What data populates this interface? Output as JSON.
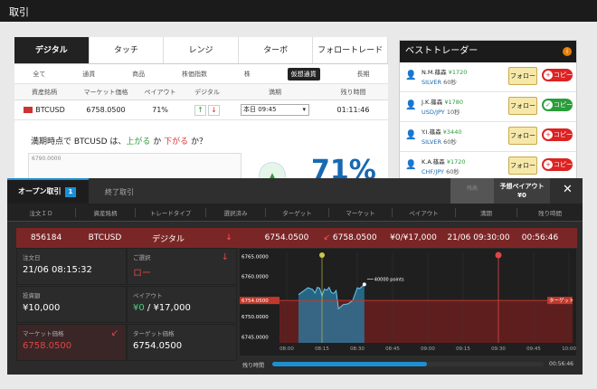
{
  "app_title": "取引",
  "product_tabs": [
    "デジタル",
    "タッチ",
    "レンジ",
    "ターボ",
    "フォロートレード"
  ],
  "filter_tabs": [
    "全て",
    "通貨",
    "商品",
    "株価指数",
    "株",
    "仮想通貨",
    "長期"
  ],
  "trade_table": {
    "headers": [
      "資産銘柄",
      "マーケット価格",
      "ペイアウト",
      "デジタル",
      "満期",
      "残り時間"
    ],
    "row": {
      "asset": "BTCUSD",
      "price": "6758.0500",
      "payout": "71%",
      "expiry": "本日 09:45",
      "remaining": "01:11:46"
    }
  },
  "question": {
    "before": "満期時点で BTCUSD は、",
    "up": "上がる",
    "mid": " か ",
    "down": "下がる",
    "after": " か？"
  },
  "mini_chart_label": "6790.0000",
  "big_payout": "71%",
  "best_traders": {
    "title": "ベストトレーダー",
    "follow_label": "フォロー",
    "copy_label": "コピー",
    "items": [
      {
        "name": "N.M.篠森",
        "gain": "¥1720",
        "asset": "SILVER",
        "period": "60秒",
        "copy_on": false
      },
      {
        "name": "J.K.篠森",
        "gain": "¥1780",
        "asset": "USD/JPY",
        "period": "10秒",
        "copy_on": true
      },
      {
        "name": "Y.I.篠森",
        "gain": "¥3440",
        "asset": "SILVER",
        "period": "60秒",
        "copy_on": false
      },
      {
        "name": "K.A.篠森",
        "gain": "¥1720",
        "asset": "CHF/JPY",
        "period": "60秒",
        "copy_on": false
      }
    ]
  },
  "open_trades": {
    "tab_open": "オープン取引",
    "open_count": "1",
    "tab_closed": "終了取引",
    "balance_label": "残高",
    "payout_label": "予想ペイアウト",
    "payout_value": "¥0",
    "close_icon": "close-icon",
    "headers": [
      "注文ＩＤ",
      "資産銘柄",
      "トレードタイプ",
      "選択済み",
      "ターゲット",
      "マーケット",
      "ペイアウト",
      "満期",
      "残り時間"
    ],
    "row": {
      "id": "856184",
      "asset": "BTCUSD",
      "type": "デジタル",
      "target": "6754.0500",
      "market": "6758.0500",
      "payout": "¥0/¥17,000",
      "expiry": "21/06 09:30:00",
      "remaining": "00:56:46"
    },
    "details": {
      "order_date_label": "注文日",
      "order_date": "21/06 08:15:32",
      "selection_label": "ご選択",
      "selection": "ロー",
      "invest_label": "投資額",
      "invest": "¥10,000",
      "payout_label": "ペイアウト",
      "payout_now": "¥0",
      "payout_total": " / ¥17,000",
      "market_label": "マーケット価格",
      "market": "6758.0500",
      "target_label": "ターゲット価格",
      "target": "6754.0500"
    },
    "remaining_label": "残り時間",
    "remaining_time": "00:56:46",
    "remaining_fraction": 0.57
  },
  "chart_data": {
    "type": "line",
    "y_ticks": [
      "6765.0000",
      "6760.0000",
      "6754.0500",
      "6750.0000",
      "6745.0000"
    ],
    "ylim": [
      6743.5,
      6766
    ],
    "x_ticks": [
      "08:00",
      "08:15",
      "08:30",
      "08:45",
      "09:00",
      "09:15",
      "09:30",
      "09:45",
      "10:00"
    ],
    "target_price": 6754.05,
    "target_label": "ターゲット",
    "annotation": "40000 points",
    "series": [
      {
        "x": [
          "08:05",
          "08:09",
          "08:11",
          "08:12",
          "08:13",
          "08:14",
          "08:15",
          "08:16",
          "08:17",
          "08:18",
          "08:19",
          "08:20",
          "08:21",
          "08:22",
          "08:24",
          "08:26",
          "08:28",
          "08:30",
          "08:31",
          "08:33"
        ],
        "values": [
          6755.5,
          6757.2,
          6756.8,
          6755.9,
          6757.3,
          6757.1,
          6755.2,
          6756.9,
          6756.6,
          6757.3,
          6756.0,
          6755.8,
          6756.5,
          6752.0,
          6753.0,
          6753.2,
          6754.0,
          6757.2,
          6757.0,
          6758.05
        ]
      }
    ]
  }
}
